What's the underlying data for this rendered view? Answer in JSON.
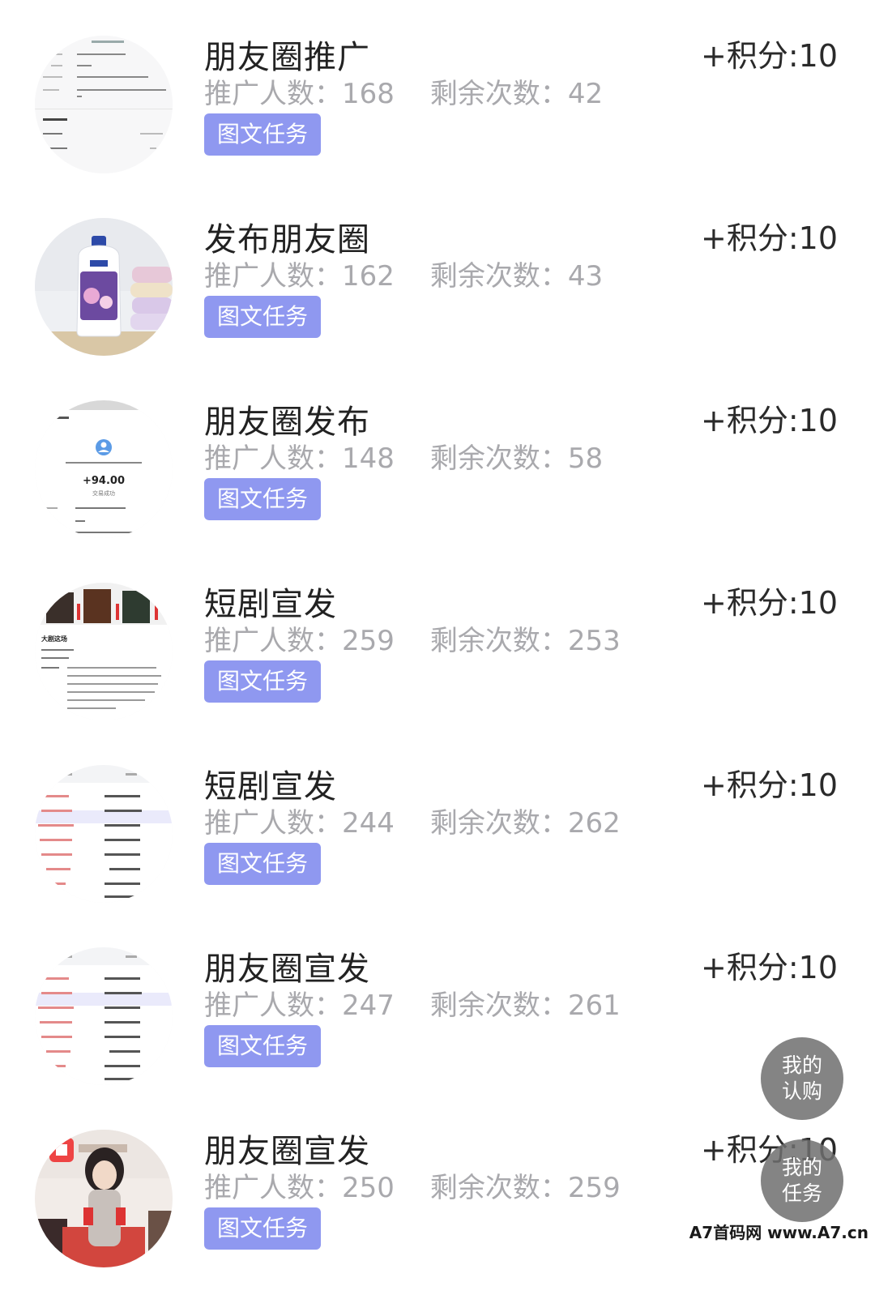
{
  "tasks": [
    {
      "title": "朋友圈推广",
      "promoters_label": "推广人数：",
      "promoters": "168",
      "remaining_label": "剩余次数：",
      "remaining": "42",
      "tag": "图文任务",
      "points": "+积分:10",
      "thumb": "receipt"
    },
    {
      "title": "发布朋友圈",
      "promoters_label": "推广人数：",
      "promoters": "162",
      "remaining_label": "剩余次数：",
      "remaining": "43",
      "tag": "图文任务",
      "points": "+积分:10",
      "thumb": "product"
    },
    {
      "title": "朋友圈发布",
      "promoters_label": "推广人数：",
      "promoters": "148",
      "remaining_label": "剩余次数：",
      "remaining": "58",
      "tag": "图文任务",
      "points": "+积分:10",
      "thumb": "transaction"
    },
    {
      "title": "短剧宣发",
      "promoters_label": "推广人数：",
      "promoters": "259",
      "remaining_label": "剩余次数：",
      "remaining": "253",
      "tag": "图文任务",
      "points": "+积分:10",
      "thumb": "drama"
    },
    {
      "title": "短剧宣发",
      "promoters_label": "推广人数：",
      "promoters": "244",
      "remaining_label": "剩余次数：",
      "remaining": "262",
      "tag": "图文任务",
      "points": "+积分:10",
      "thumb": "table"
    },
    {
      "title": "朋友圈宣发",
      "promoters_label": "推广人数：",
      "promoters": "247",
      "remaining_label": "剩余次数：",
      "remaining": "261",
      "tag": "图文任务",
      "points": "+积分:10",
      "thumb": "table"
    },
    {
      "title": "朋友圈宣发",
      "promoters_label": "推广人数：",
      "promoters": "250",
      "remaining_label": "剩余次数：",
      "remaining": "259",
      "tag": "图文任务",
      "points": "+积分:10",
      "thumb": "person"
    }
  ],
  "fab": {
    "subscriptions_line1": "我的",
    "subscriptions_line2": "认购",
    "tasks_line1": "我的",
    "tasks_line2": "任务"
  },
  "thumb_text": {
    "transaction_amount": "+94.00",
    "transaction_status": "交易成功",
    "drama_heading": "大剧这场"
  },
  "watermark": "A7首码网 www.A7.cn",
  "colors": {
    "tag_bg": "#8f98f0",
    "fab_bg": "#6e6e6e",
    "muted_text": "#a9a9ad"
  }
}
